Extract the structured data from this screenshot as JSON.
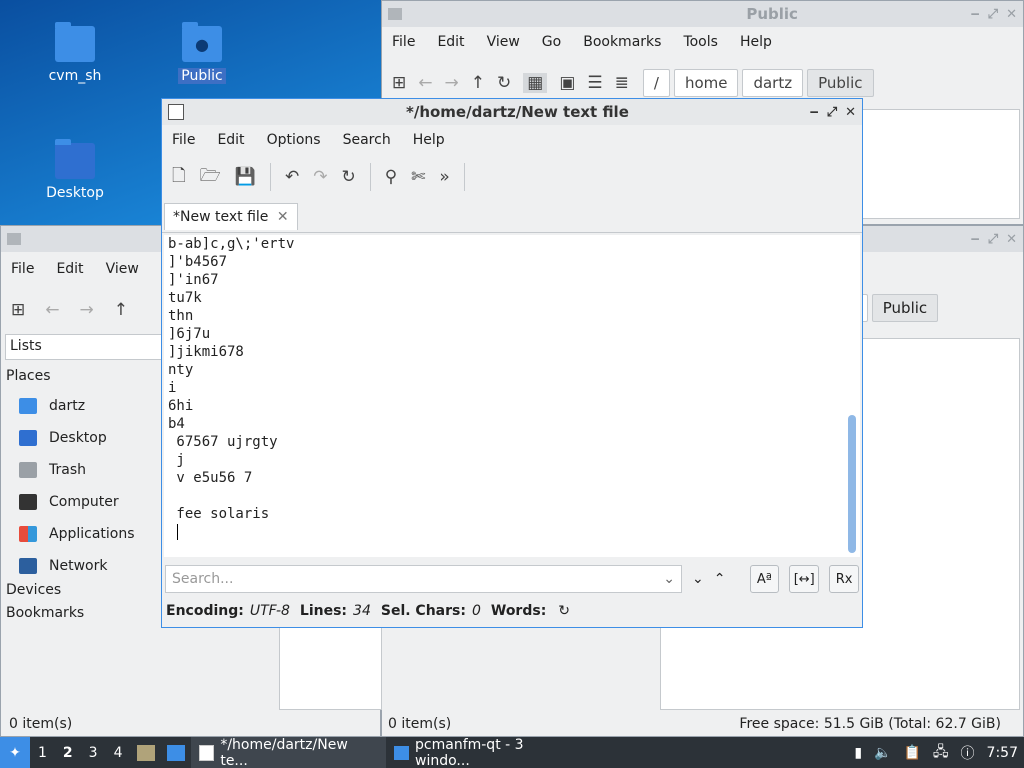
{
  "desktop": {
    "icons": [
      {
        "label": "cvm_sh"
      },
      {
        "label": "Public"
      },
      {
        "label": "Desktop"
      }
    ]
  },
  "fm_back": {
    "title": "Public",
    "menu": [
      "File",
      "Edit",
      "View",
      "Go",
      "Bookmarks",
      "Tools",
      "Help"
    ],
    "crumbs": [
      "/",
      "home",
      "dartz",
      "Public"
    ],
    "status_free": "Free space: 51.5 GiB (Total: 62.7 GiB)",
    "status_items": "0 item(s)"
  },
  "fm_mid": {
    "crumb_partial": "tz",
    "crumb_cur": "Public"
  },
  "fm_left": {
    "menu": [
      "File",
      "Edit",
      "View"
    ],
    "view_select": "Lists",
    "places_heading": "Places",
    "places": [
      "dartz",
      "Desktop",
      "Trash",
      "Computer",
      "Applications",
      "Network"
    ],
    "devices_heading": "Devices",
    "bookmarks_heading": "Bookmarks",
    "status_items": "0 item(s)"
  },
  "editor": {
    "title": "*/home/dartz/New text file",
    "menu": [
      "File",
      "Edit",
      "Options",
      "Search",
      "Help"
    ],
    "tab_label": "*New text file",
    "text_lines": [
      "b-ab]c,g\\;'ertv",
      "]'b4567",
      "]'in67",
      "tu7k",
      "thn",
      "]6j7u",
      "]jikmi678",
      "nty",
      "i",
      "6hi",
      "b4",
      " 67567 ujrgty",
      " j",
      " v e5u56 7",
      "",
      " fee solaris",
      " "
    ],
    "search_placeholder": "Search...",
    "status": {
      "encoding_label": "Encoding:",
      "encoding_value": "UTF-8",
      "lines_label": "Lines:",
      "lines_value": "34",
      "sel_label": "Sel. Chars:",
      "sel_value": "0",
      "words_label": "Words:"
    }
  },
  "taskbar": {
    "workspaces": [
      "1",
      "2",
      "3",
      "4"
    ],
    "tasks": [
      {
        "label": "*/home/dartz/New te..."
      },
      {
        "label": "pcmanfm-qt - 3 windo..."
      }
    ],
    "clock": "7:57"
  }
}
